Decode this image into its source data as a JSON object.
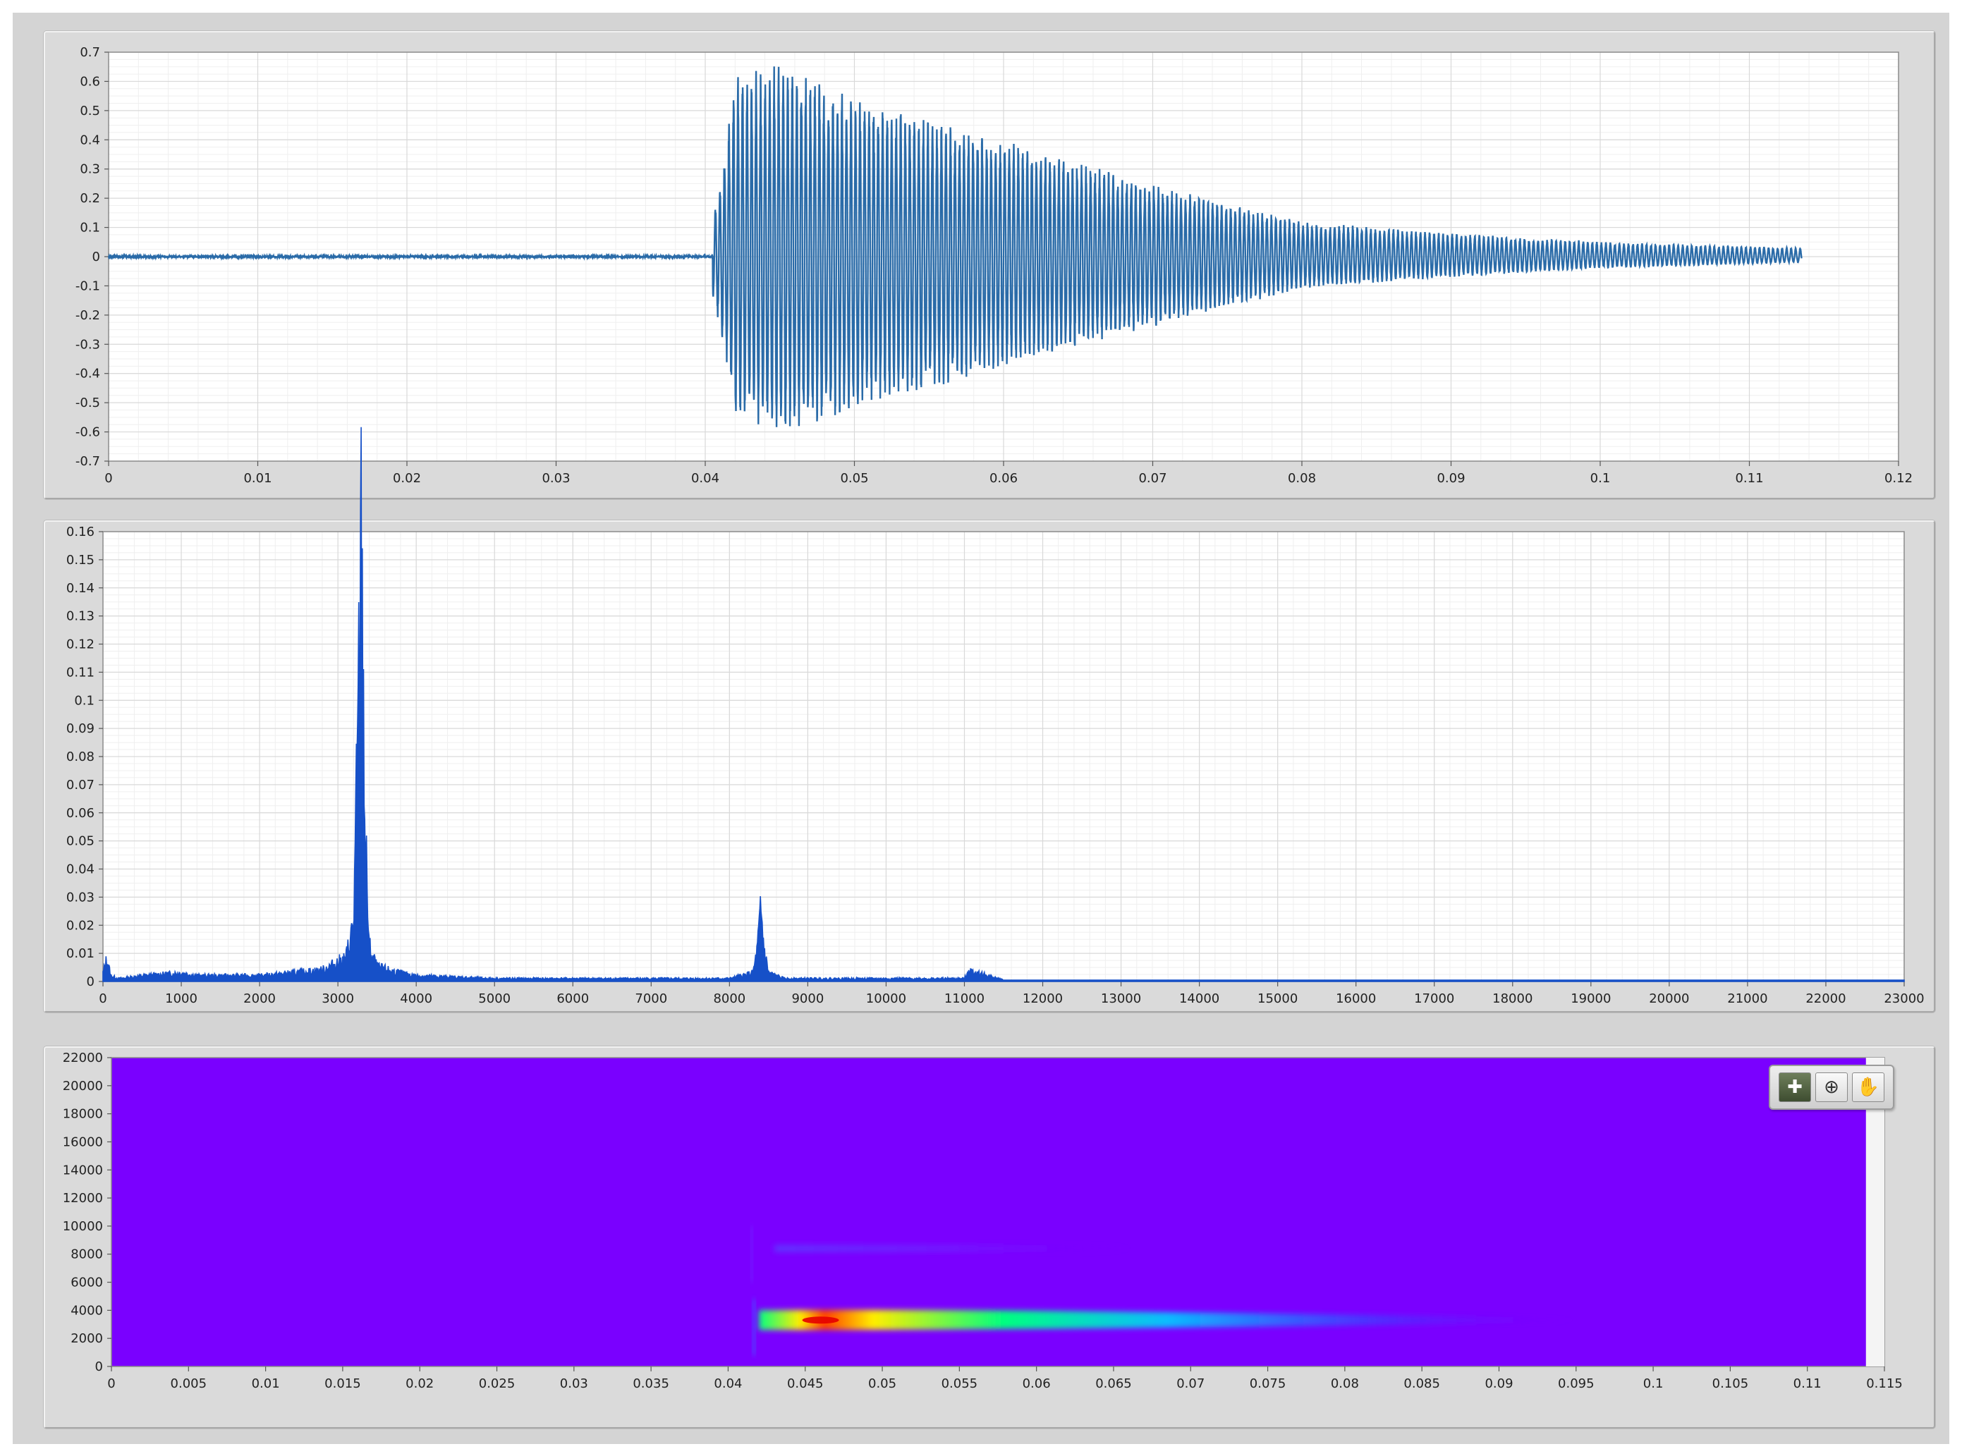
{
  "waveform_panel": {
    "y_ticks": [
      "0.7",
      "0.6",
      "0.5",
      "0.4",
      "0.3",
      "0.2",
      "0.1",
      "0",
      "-0.1",
      "-0.2",
      "-0.3",
      "-0.4",
      "-0.5",
      "-0.6",
      "-0.7"
    ],
    "x_ticks": [
      "0",
      "0.01",
      "0.02",
      "0.03",
      "0.04",
      "0.05",
      "0.06",
      "0.07",
      "0.08",
      "0.09",
      "0.1",
      "0.11",
      "0.12"
    ],
    "trace_color": "#2a6ba8"
  },
  "spectrum_panel": {
    "y_ticks": [
      "0.16",
      "0.15",
      "0.14",
      "0.13",
      "0.12",
      "0.11",
      "0.1",
      "0.09",
      "0.08",
      "0.07",
      "0.06",
      "0.05",
      "0.04",
      "0.03",
      "0.02",
      "0.01",
      "0"
    ],
    "x_ticks": [
      "0",
      "1000",
      "2000",
      "3000",
      "4000",
      "5000",
      "6000",
      "7000",
      "8000",
      "9000",
      "10000",
      "11000",
      "12000",
      "13000",
      "14000",
      "15000",
      "16000",
      "17000",
      "18000",
      "19000",
      "20000",
      "21000",
      "22000",
      "23000"
    ],
    "trace_color": "#1650c8"
  },
  "spectrogram_panel": {
    "y_ticks": [
      "22000",
      "20000",
      "18000",
      "16000",
      "14000",
      "12000",
      "10000",
      "8000",
      "6000",
      "4000",
      "2000",
      "0"
    ],
    "x_ticks": [
      "0",
      "0.005",
      "0.01",
      "0.015",
      "0.02",
      "0.025",
      "0.03",
      "0.035",
      "0.04",
      "0.045",
      "0.05",
      "0.055",
      "0.06",
      "0.065",
      "0.07",
      "0.075",
      "0.08",
      "0.085",
      "0.09",
      "0.095",
      "0.1",
      "0.105",
      "0.11",
      "0.115"
    ],
    "background_color": "#7a00ff",
    "palette": {
      "cursor_tool_icon": "crosshair-icon",
      "zoom_tool_icon": "zoom-icon",
      "pan_tool_icon": "hand-icon"
    }
  },
  "chart_data": [
    {
      "type": "line",
      "x": [
        0,
        0.04,
        0.041,
        0.042,
        0.045,
        0.05,
        0.06,
        0.07,
        0.08,
        0.09,
        0.1,
        0.1135
      ],
      "envelope_max": [
        0.01,
        0.01,
        0.25,
        0.62,
        0.66,
        0.55,
        0.4,
        0.25,
        0.12,
        0.08,
        0.05,
        0.03
      ],
      "envelope_min": [
        -0.01,
        -0.01,
        -0.25,
        -0.55,
        -0.61,
        -0.53,
        -0.38,
        -0.24,
        -0.11,
        -0.07,
        -0.04,
        -0.02
      ],
      "ylim": [
        -0.7,
        0.7
      ],
      "xlim": [
        0,
        0.12
      ],
      "grid": true
    },
    {
      "type": "area",
      "x": [
        0,
        50,
        100,
        200,
        500,
        1000,
        1200,
        2000,
        2800,
        3100,
        3200,
        3250,
        3300,
        3350,
        3400,
        3500,
        3800,
        4000,
        5000,
        7000,
        8000,
        8300,
        8350,
        8400,
        8450,
        8500,
        8700,
        9000,
        10000,
        11000,
        11050,
        11500,
        23000
      ],
      "y": [
        0.003,
        0.008,
        0.002,
        0.001,
        0.002,
        0.003,
        0.002,
        0.002,
        0.004,
        0.008,
        0.02,
        0.08,
        0.154,
        0.05,
        0.012,
        0.005,
        0.003,
        0.002,
        0.001,
        0.001,
        0.001,
        0.003,
        0.01,
        0.024,
        0.01,
        0.003,
        0.001,
        0.001,
        0.001,
        0.001,
        0.004,
        0.0005,
        0.0005
      ],
      "ylim": [
        0,
        0.16
      ],
      "xlim": [
        0,
        23000
      ],
      "grid": true
    },
    {
      "type": "heatmap",
      "xlim": [
        0,
        0.115
      ],
      "ylim": [
        0,
        22000
      ],
      "bands": [
        {
          "freq": 3300,
          "t_start": 0.042,
          "t_end": 0.095,
          "peak_t": 0.046
        },
        {
          "freq": 8400,
          "t_start": 0.043,
          "t_end": 0.058,
          "peak_t": 0.045
        }
      ]
    }
  ]
}
